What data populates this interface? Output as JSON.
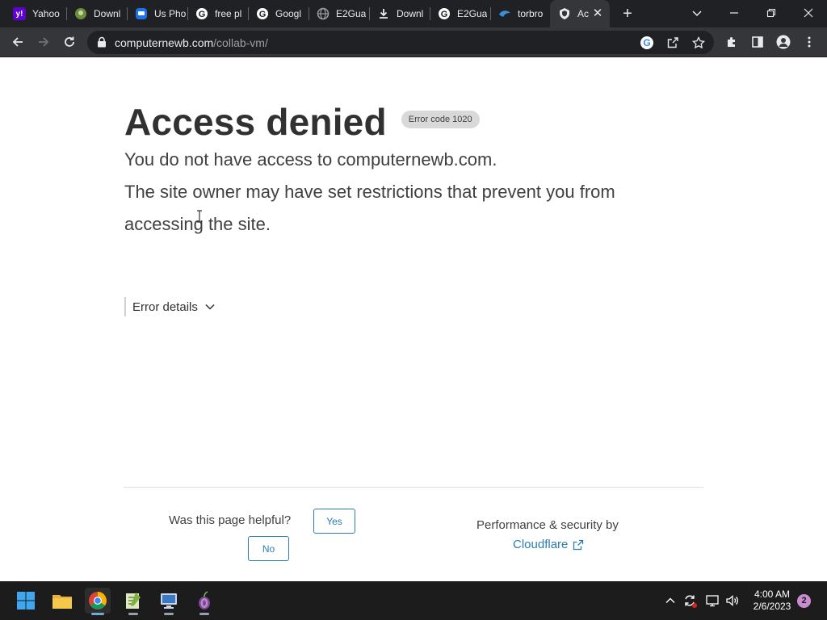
{
  "browser": {
    "tabs": [
      {
        "title": "Yahoo",
        "icon": "yahoo-icon",
        "color": "#6001d2"
      },
      {
        "title": "Downl",
        "icon": "download-site-icon",
        "color": "#6b8e3a"
      },
      {
        "title": "Us Pho",
        "icon": "messenger-icon",
        "color": "#1a73e8"
      },
      {
        "title": "free pl",
        "icon": "google-icon",
        "color": "#ffffff"
      },
      {
        "title": "Googl",
        "icon": "google-icon",
        "color": "#ffffff"
      },
      {
        "title": "E2Gua",
        "icon": "globe-icon",
        "color": "#9aa0a6"
      },
      {
        "title": "Downl",
        "icon": "download-icon",
        "color": "#e8eaed"
      },
      {
        "title": "E2Gua",
        "icon": "google-icon",
        "color": "#ffffff"
      },
      {
        "title": "torbro",
        "icon": "torbrowser-icon",
        "color": "#3b8fd6"
      },
      {
        "title": "Ac",
        "icon": "cloudflare-site-icon",
        "color": "#e8eaed"
      }
    ],
    "url_host": "computernewb.com",
    "url_path": "/collab-vm/"
  },
  "page": {
    "heading": "Access denied",
    "error_code": "Error code 1020",
    "message_line1": "You do not have access to computernewb.com.",
    "message_line2": "The site owner may have set restrictions that prevent you from",
    "message_line3": "accessing the site.",
    "details_label": "Error details",
    "helpful_question": "Was this page helpful?",
    "yes_label": "Yes",
    "no_label": "No",
    "perf_label": "Performance & security by",
    "cloudflare_label": "Cloudflare"
  },
  "taskbar": {
    "time": "4:00 AM",
    "date": "2/6/2023",
    "notification_count": "2"
  },
  "colors": {
    "link": "#2c7cb0",
    "tab_strip": "#202124",
    "toolbar": "#35363a"
  }
}
